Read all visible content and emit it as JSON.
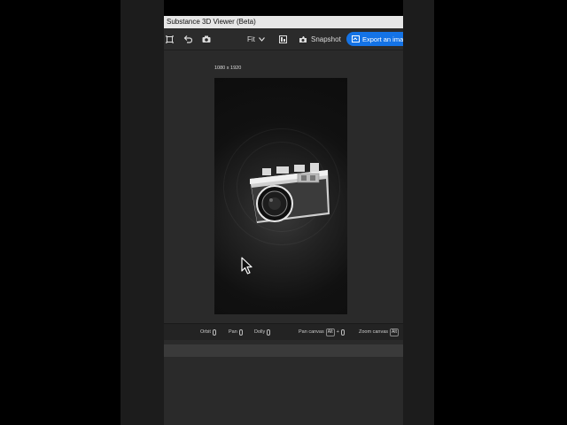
{
  "window": {
    "title": "Substance 3D Viewer (Beta)"
  },
  "toolbar": {
    "fit_label": "Fit",
    "snapshot_label": "Snapshot",
    "export_label": "Export an image"
  },
  "canvas": {
    "dimensions_label": "1080 x 1920"
  },
  "statusbar": {
    "orbit_label": "Orbit",
    "pan_label": "Pan",
    "dolly_label": "Dolly",
    "pan_canvas_label": "Pan canvas",
    "pan_canvas_key": "Alt",
    "plus": "+",
    "zoom_canvas_label": "Zoom canvas",
    "zoom_canvas_key": "Alt"
  },
  "colors": {
    "accent": "#1473e6",
    "background": "#2a2a2a",
    "titlebar": "#e6e6e6"
  }
}
